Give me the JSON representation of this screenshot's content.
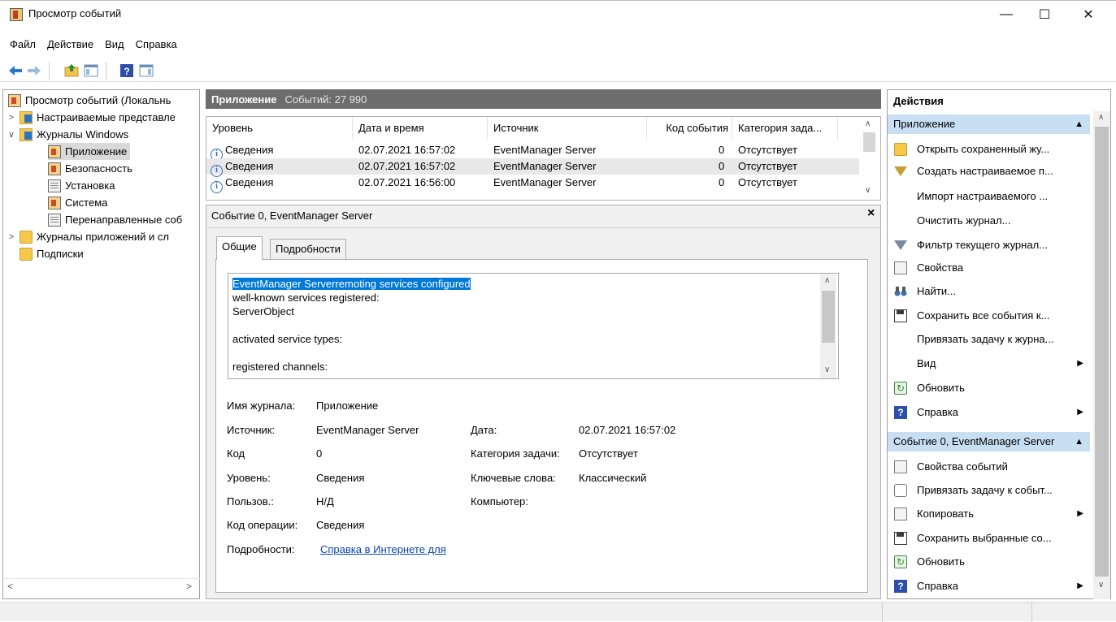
{
  "window": {
    "title": "Просмотр событий",
    "min_glyph": "—",
    "max_glyph": "☐",
    "close_glyph": "✕"
  },
  "menu": [
    "Файл",
    "Действие",
    "Вид",
    "Справка"
  ],
  "toolbar_icons": [
    "back-arrow-icon",
    "forward-arrow-icon",
    "up-folder-icon",
    "show-hide-console-tree-icon",
    "help-icon",
    "show-hide-action-pane-icon"
  ],
  "tree": {
    "root": "Просмотр событий (Локальнь",
    "custom_views": "Настраиваемые представле",
    "windows_logs": "Журналы Windows",
    "application": "Приложение",
    "security": "Безопасность",
    "setup": "Установка",
    "system": "Система",
    "forwarded": "Перенаправленные соб",
    "app_logs": "Журналы приложений и сл",
    "subscriptions": "Подписки"
  },
  "center": {
    "log_name": "Приложение",
    "count_text": "Событий: 27 990",
    "columns": [
      "Уровень",
      "Дата и время",
      "Источник",
      "Код события",
      "Категория зада..."
    ],
    "rows": [
      {
        "level": "Сведения",
        "datetime": "02.07.2021 16:57:02",
        "source": "EventManager Server",
        "code": "0",
        "category": "Отсутствует"
      },
      {
        "level": "Сведения",
        "datetime": "02.07.2021 16:57:02",
        "source": "EventManager Server",
        "code": "0",
        "category": "Отсутствует"
      },
      {
        "level": "Сведения",
        "datetime": "02.07.2021 16:56:00",
        "source": "EventManager Server",
        "code": "0",
        "category": "Отсутствует"
      }
    ]
  },
  "detail": {
    "title": "Событие 0, EventManager Server",
    "close": "×",
    "tabs": [
      "Общие",
      "Подробности"
    ],
    "description_lines": [
      "EventManager Serverremoting services configured",
      "well-known services registered:",
      "ServerObject",
      "",
      "activated service types:",
      "",
      "registered channels:"
    ],
    "fields": {
      "log_name_label": "Имя журнала:",
      "log_name_value": "Приложение",
      "source_label": "Источник:",
      "source_value": "EventManager Server",
      "date_label": "Дата:",
      "date_value": "02.07.2021 16:57:02",
      "code_label": "Код",
      "code_value": "0",
      "task_label": "Категория задачи:",
      "task_value": "Отсутствует",
      "level_label": "Уровень:",
      "level_value": "Сведения",
      "keywords_label": "Ключевые слова:",
      "keywords_value": "Классический",
      "user_label": "Пользов.:",
      "user_value": "Н/Д",
      "computer_label": "Компьютер:",
      "opcode_label": "Код операции:",
      "opcode_value": "Сведения",
      "more_label": "Подробности:",
      "more_link": "Справка в Интернете для "
    }
  },
  "actions": {
    "header": "Действия",
    "section1": "Приложение",
    "items1": [
      "Открыть сохраненный жу...",
      "Создать настраиваемое п...",
      "Импорт настраиваемого ...",
      "Очистить журнал...",
      "Фильтр текущего журнал...",
      "Свойства",
      "Найти...",
      "Сохранить все события к...",
      "Привязать задачу к журна...",
      "Вид",
      "Обновить",
      "Справка"
    ],
    "section2": "Событие 0, EventManager Server",
    "items2": [
      "Свойства событий",
      "Привязать задачу к событ...",
      "Копировать",
      "Сохранить выбранные со...",
      "Обновить",
      "Справка"
    ]
  },
  "colors": {
    "header_gray": "#6d6d6d",
    "section_blue": "#c8dff3",
    "selection_blue": "#0078d7",
    "link_blue": "#0645ad"
  }
}
